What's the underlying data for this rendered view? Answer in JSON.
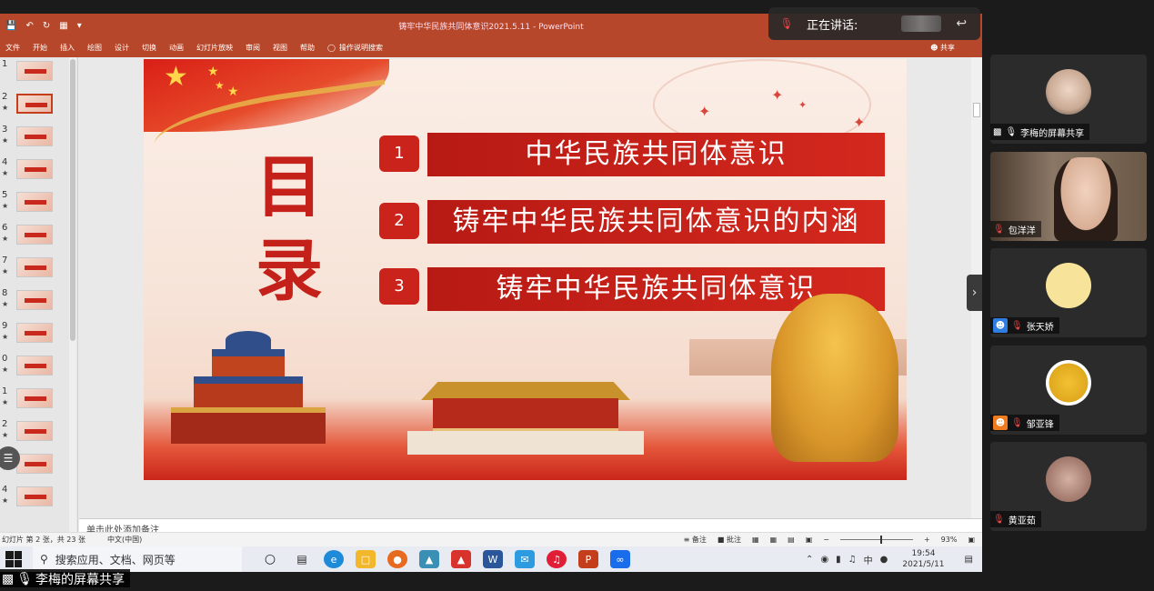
{
  "ppt": {
    "doc_title": "铸牢中华民族共同体意识2021.5.11  -  PowerPoint",
    "ribbon_tabs": [
      "文件",
      "开始",
      "插入",
      "绘图",
      "设计",
      "切换",
      "动画",
      "幻灯片放映",
      "审阅",
      "视图",
      "帮助"
    ],
    "tell_me": "操作说明搜索",
    "share_label": "共享",
    "thumbnail_numbers": [
      "1",
      "2",
      "3",
      "4",
      "5",
      "6",
      "7",
      "8",
      "9",
      "0",
      "1",
      "2",
      "3",
      "4"
    ],
    "notes_placeholder": "单击此处添加备注",
    "status": {
      "slide_info": "幻灯片 第 2 张，共 23 张",
      "language": "中文(中国)",
      "notes_btn": "备注",
      "comments_btn": "批注",
      "zoom": "93%"
    }
  },
  "slide": {
    "heading_chars": [
      "目",
      "录"
    ],
    "items": [
      {
        "num": "1",
        "text": "中华民族共同体意识"
      },
      {
        "num": "2",
        "text": "铸牢中华民族共同体意识的内涵"
      },
      {
        "num": "3",
        "text": "铸牢中华民族共同体意识"
      }
    ]
  },
  "speaking": {
    "label": "正在讲话:"
  },
  "taskbar": {
    "search_placeholder": "搜索应用、文档、网页等",
    "time": "19:54",
    "date": "2021/5/11",
    "ime": "中"
  },
  "share_caption": "李梅的屏幕共享",
  "participants": [
    {
      "name": "李梅的屏幕共享",
      "mic": "on",
      "avatar_color": "#d9c2b0"
    },
    {
      "name": "包洋洋",
      "mic": "off",
      "avatar_color": "#d8ae95"
    },
    {
      "name": "张天娇",
      "mic": "off",
      "avatar_color": "#f7e39a"
    },
    {
      "name": "邹亚锋",
      "mic": "off",
      "avatar_color": "#f2c232"
    },
    {
      "name": "黄亚茹",
      "mic": "off",
      "avatar_color": "#b8897a"
    }
  ]
}
